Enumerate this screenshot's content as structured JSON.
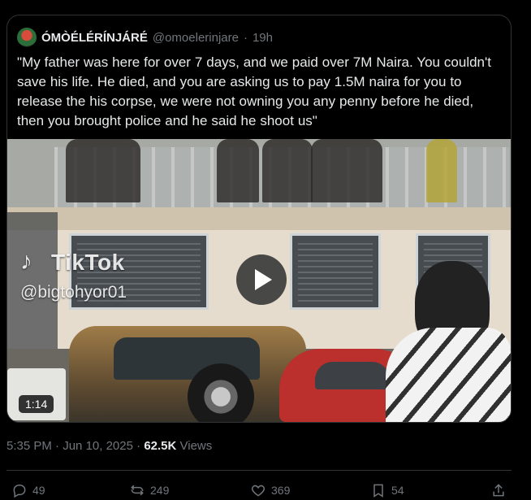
{
  "quote": {
    "display_name": "ÓMÒÉLÉRÍNJÁRÉ",
    "handle": "@omoelerinjare",
    "separator": "·",
    "age": "19h",
    "text": "\"My father was here for over 7 days, and we paid over 7M Naira. You couldn't save his life. He died, and you are asking us to pay 1.5M naira for you to release the his corpse, we were not owning you any penny before he died, then you brought police and he said he shoot us\"",
    "media": {
      "watermark_logo": "♪",
      "watermark_brand": "TikTok",
      "watermark_handle": "@bigtohyor01",
      "duration": "1:14"
    }
  },
  "post_meta": {
    "time": "5:35 PM",
    "separator": "·",
    "date": "Jun 10, 2025",
    "views_count": "62.5K",
    "views_label": "Views"
  },
  "actions": {
    "replies": "49",
    "reposts": "249",
    "likes": "369",
    "bookmarks": "54"
  },
  "icons": {
    "reply": "reply-icon",
    "repost": "repost-icon",
    "like": "heart-icon",
    "bookmark": "bookmark-icon",
    "share": "share-icon",
    "play": "play-icon"
  },
  "colors": {
    "background": "#000000",
    "primary_text": "#e7e9ea",
    "secondary_text": "#71767b",
    "border": "#2f3336"
  }
}
